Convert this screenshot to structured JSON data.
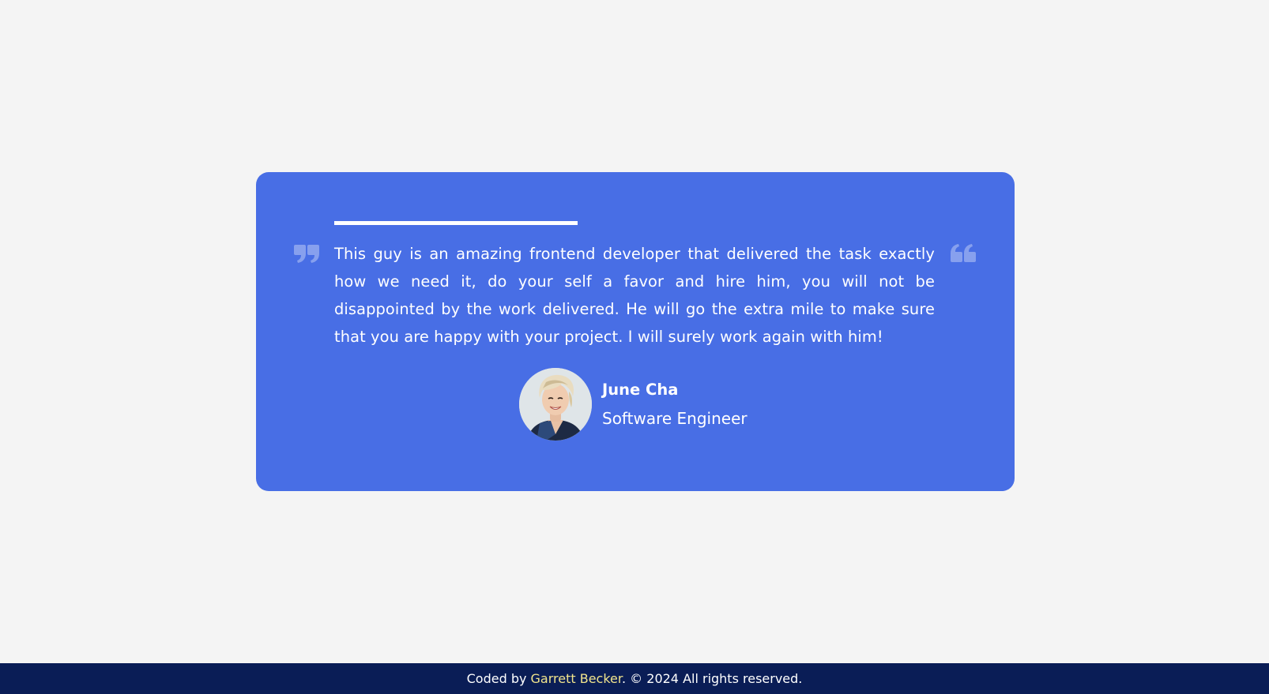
{
  "testimonial": {
    "quote": "This guy is an amazing frontend developer that delivered the task exactly how we need it, do your self a favor and hire him, you will not be disappointed by the work delivered. He will go the extra mile to make sure that you are happy with your project. I will surely work again with him!",
    "progress": 1.0,
    "author_name": "June Cha",
    "author_role": "Software Engineer",
    "quote_open_icon": "quote-open-icon",
    "quote_close_icon": "quote-close-icon",
    "avatar_icon": "avatar-photo"
  },
  "footer": {
    "prefix": "Coded by ",
    "author_link": "Garrett Becker",
    "suffix": ". © 2024 All rights reserved."
  },
  "colors": {
    "page_background": "#f4f4f4",
    "card_background": "#486ee5",
    "footer_background": "#0a1d56",
    "footer_link": "#f1e48c",
    "text": "#ffffff"
  }
}
